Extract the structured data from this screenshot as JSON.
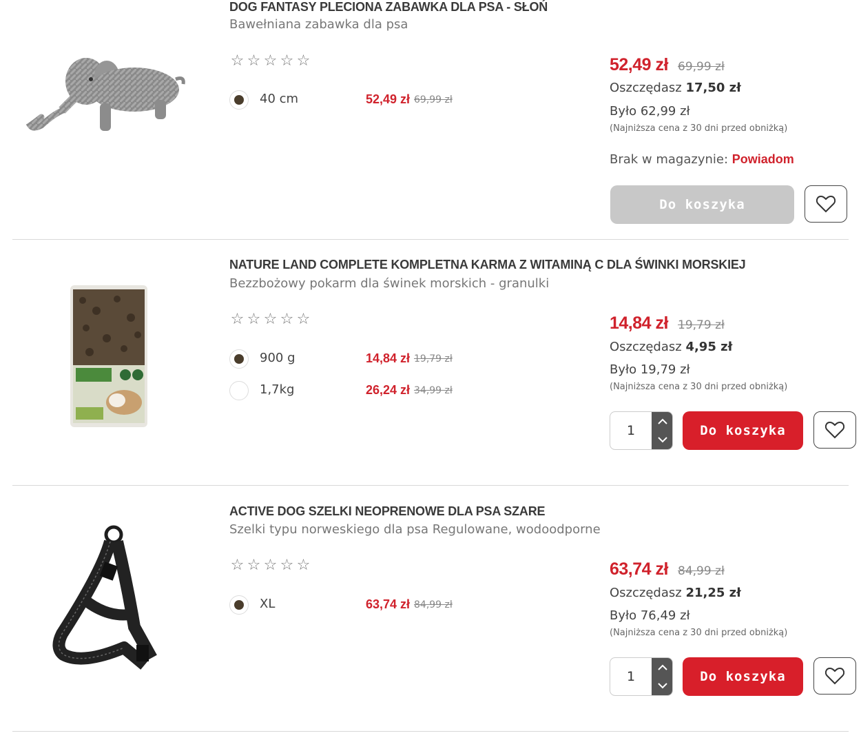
{
  "products": [
    {
      "title": "DOG FANTASY PLECIONA ZABAWKA DLA PSA - SŁOŃ",
      "subtitle": "Bawełniana zabawka dla psa",
      "image_icon": "rope-elephant-toy-image",
      "stars": [
        "☆",
        "☆",
        "☆",
        "☆",
        "☆"
      ],
      "variants": [
        {
          "label": "40 cm",
          "price": "52,49 zł",
          "old_price": "69,99 zł",
          "selected": true
        }
      ],
      "price": "52,49 zł",
      "old_price": "69,99 zł",
      "save_label": "Oszczędasz",
      "save_value": "17,50 zł",
      "was": "Było 62,99 zł",
      "lowest_note": "(Najniższa cena z 30 dni przed obniżką)",
      "stock_label": "Brak w magazynie:",
      "stock_link": "Powiadom",
      "cart_label": "Do koszyka",
      "cart_enabled": false
    },
    {
      "title": "NATURE LAND COMPLETE KOMPLETNA KARMA Z WITAMINĄ C DLA ŚWINKI MORSKIEJ",
      "subtitle": "Bezzbożowy pokarm dla świnek morskich - granulki",
      "image_icon": "guinea-pig-food-bag-image",
      "stars": [
        "☆",
        "☆",
        "☆",
        "☆",
        "☆"
      ],
      "variants": [
        {
          "label": "900 g",
          "price": "14,84 zł",
          "old_price": "19,79 zł",
          "selected": true
        },
        {
          "label": "1,7kg",
          "price": "26,24 zł",
          "old_price": "34,99 zł",
          "selected": false
        }
      ],
      "price": "14,84 zł",
      "old_price": "19,79 zł",
      "save_label": "Oszczędasz",
      "save_value": "4,95 zł",
      "was": "Było 19,79 zł",
      "lowest_note": "(Najniższa cena z 30 dni przed obniżką)",
      "quantity": "1",
      "cart_label": "Do koszyka",
      "cart_enabled": true
    },
    {
      "title": "ACTIVE DOG SZELKI NEOPRENOWE DLA PSA SZARE",
      "subtitle": "Szelki typu norweskiego dla psa Regulowane, wodoodporne",
      "image_icon": "dog-harness-image",
      "stars": [
        "☆",
        "☆",
        "☆",
        "☆",
        "☆"
      ],
      "variants": [
        {
          "label": "XL",
          "price": "63,74 zł",
          "old_price": "84,99 zł",
          "selected": true
        }
      ],
      "price": "63,74 zł",
      "old_price": "84,99 zł",
      "save_label": "Oszczędasz",
      "save_value": "21,25 zł",
      "was": "Było 76,49 zł",
      "lowest_note": "(Najniższa cena z 30 dni przed obniżką)",
      "quantity": "1",
      "cart_label": "Do koszyka",
      "cart_enabled": true
    }
  ],
  "colors": {
    "accent": "#d81f2a",
    "disabled": "#c8c8c8",
    "radio_on": "#4a3d2c"
  }
}
